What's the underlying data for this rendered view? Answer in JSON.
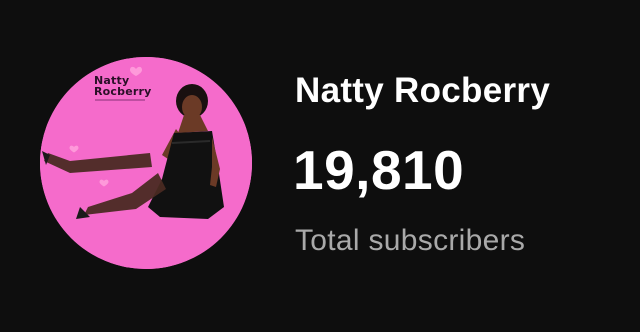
{
  "channel": {
    "name": "Natty Rocberry",
    "subscriber_count": "19,810",
    "subscriber_label": "Total subscribers",
    "avatar_logo_text": "Natty\nRocberry"
  },
  "colors": {
    "background": "#0e0e0e",
    "avatar_background": "#f56bcb",
    "primary_text": "#ffffff",
    "secondary_text": "#a9a9a9",
    "logo_text": "#2a0f27"
  }
}
